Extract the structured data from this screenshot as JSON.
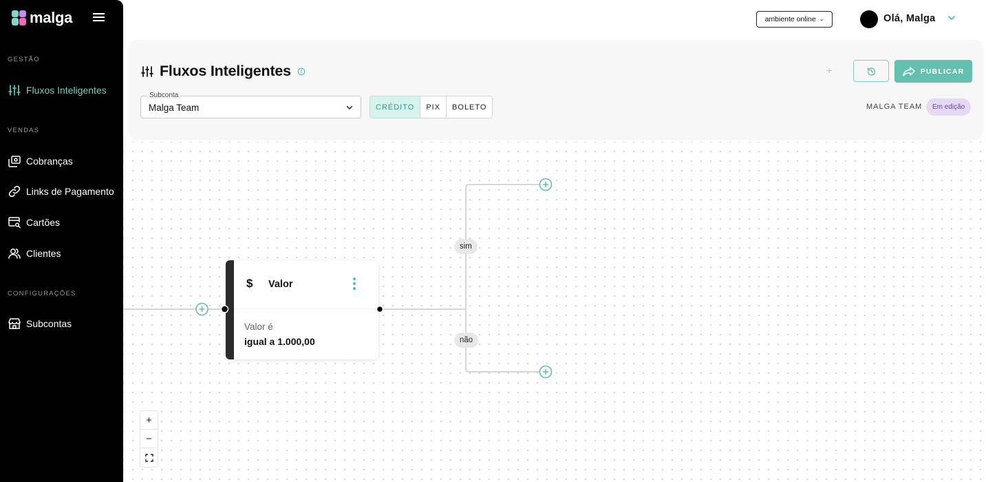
{
  "app": {
    "logo_text": "malga",
    "accent": "#63bfae",
    "brand_colors": [
      "#7fd6c2",
      "#c58ee8",
      "#f06bb5"
    ]
  },
  "sidebar": {
    "sections": [
      {
        "label": "GESTÃO"
      },
      {
        "label": "VENDAS"
      },
      {
        "label": "CONFIGURAÇÕES"
      }
    ],
    "items": [
      {
        "label": "Fluxos Inteligentes",
        "icon": "sliders-icon",
        "active": true
      },
      {
        "label": "Cobranças",
        "icon": "charges-icon"
      },
      {
        "label": "Links de Pagamento",
        "icon": "link-icon"
      },
      {
        "label": "Cartões",
        "icon": "card-search-icon"
      },
      {
        "label": "Clientes",
        "icon": "users-icon"
      },
      {
        "label": "Subcontas",
        "icon": "store-icon"
      }
    ]
  },
  "header": {
    "environment": "ambiente online",
    "greeting": "Olá, Malga"
  },
  "card": {
    "title": "Fluxos Inteligentes",
    "publish_label": "PUBLICAR",
    "add_label": "+",
    "subconta": {
      "label": "Subconta",
      "value": "Malga Team"
    },
    "tabs": [
      {
        "label": "CRÉDITO",
        "active": true
      },
      {
        "label": "PIX"
      },
      {
        "label": "BOLETO"
      }
    ],
    "team_name": "MALGA TEAM",
    "status": "Em edição",
    "status_color": "#e6d9f6"
  },
  "flow": {
    "node": {
      "icon": "$",
      "title": "Valor",
      "condition_label": "Valor é",
      "condition_value": "igual a 1.000,00"
    },
    "branches": {
      "yes": "sim",
      "no": "não"
    }
  },
  "zoom": {
    "in": "+",
    "out": "−",
    "fit": "⛶"
  }
}
